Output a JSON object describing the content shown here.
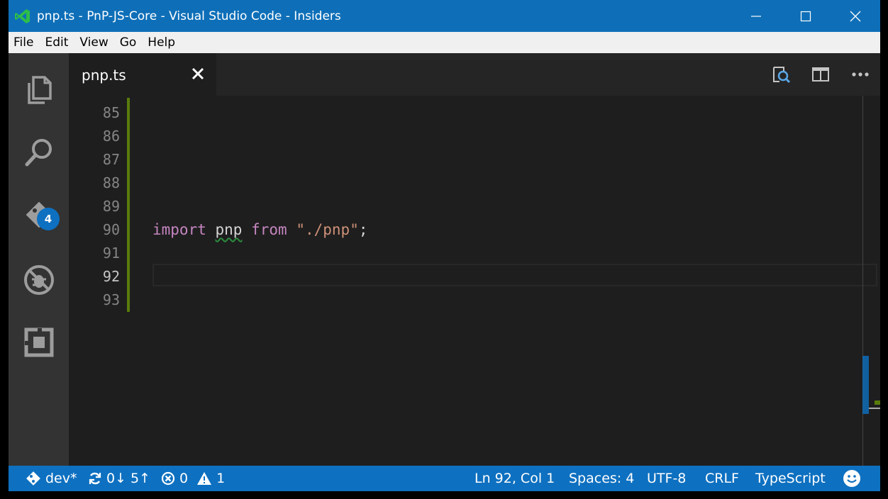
{
  "window": {
    "title": "pnp.ts - PnP-JS-Core - Visual Studio Code - Insiders",
    "titlebar_color": "#0e6fb8"
  },
  "menu": [
    "File",
    "Edit",
    "View",
    "Go",
    "Help"
  ],
  "activity_bar": {
    "items": [
      "explorer-icon",
      "search-icon",
      "git-icon",
      "debug-icon",
      "extensions-icon"
    ],
    "git_badge": "4"
  },
  "tabs": [
    {
      "label": "pnp.ts",
      "close_icon": "close-icon"
    }
  ],
  "editor_actions": [
    "open-changes-icon",
    "split-editor-icon",
    "more-icon"
  ],
  "editor": {
    "line_numbers": [
      "85",
      "86",
      "87",
      "88",
      "89",
      "90",
      "91",
      "92",
      "93"
    ],
    "code": {
      "kw1": "import",
      "ident": "pnp",
      "kw2": "from",
      "str": "\"./pnp\"",
      "semi": ";"
    },
    "current_line": "92"
  },
  "status": {
    "branch": "dev*",
    "sync": "0↓ 5↑",
    "errors": "0",
    "warnings": "1",
    "position": "Ln 92, Col 1",
    "indent": "Spaces: 4",
    "encoding": "UTF-8",
    "eol": "CRLF",
    "language": "TypeScript",
    "statusbar_color": "#0e70c0"
  }
}
